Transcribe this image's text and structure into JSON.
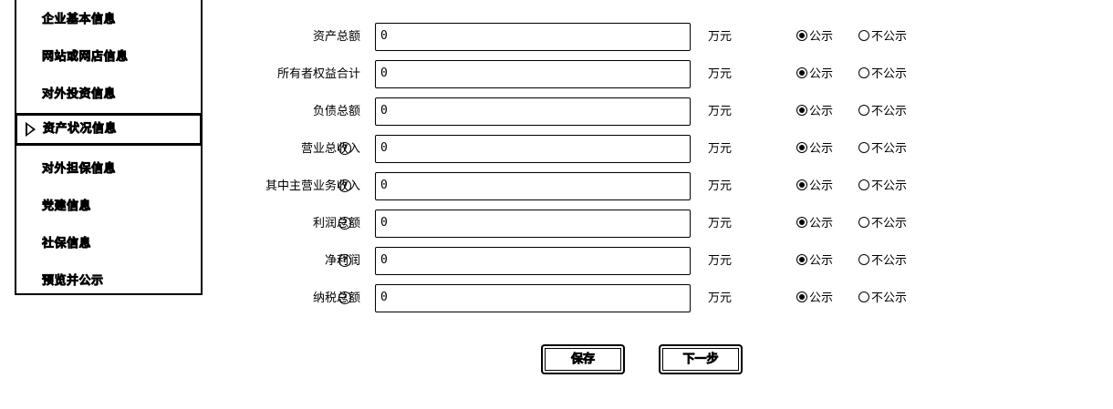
{
  "sidebar": {
    "items": [
      {
        "label": "企业基本信息"
      },
      {
        "label": "网站或网店信息"
      },
      {
        "label": "对外投资信息"
      },
      {
        "label": "资产状况信息"
      },
      {
        "label": "对外担保信息"
      },
      {
        "label": "党建信息"
      },
      {
        "label": "社保信息"
      },
      {
        "label": "预览并公示"
      }
    ],
    "active_index": 3
  },
  "form": {
    "unit": "万元",
    "public_label": "公示",
    "not_public_label": "不公示",
    "help_symbol": "?",
    "rows": [
      {
        "label": "资产总额",
        "value": "0",
        "public": true,
        "has_help": false
      },
      {
        "label": "所有者权益合计",
        "value": "0",
        "public": true,
        "has_help": false
      },
      {
        "label": "负债总额",
        "value": "0",
        "public": true,
        "has_help": false
      },
      {
        "label": "营业总收入",
        "value": "0",
        "public": true,
        "has_help": true
      },
      {
        "label": "其中主营业务收入",
        "value": "0",
        "public": true,
        "has_help": true
      },
      {
        "label": "利润总额",
        "value": "0",
        "public": true,
        "has_help": true
      },
      {
        "label": "净利润",
        "value": "0",
        "public": true,
        "has_help": true
      },
      {
        "label": "纳税总额",
        "value": "0",
        "public": true,
        "has_help": true
      }
    ]
  },
  "buttons": {
    "save_label": "保存",
    "next_label": "下一步"
  }
}
